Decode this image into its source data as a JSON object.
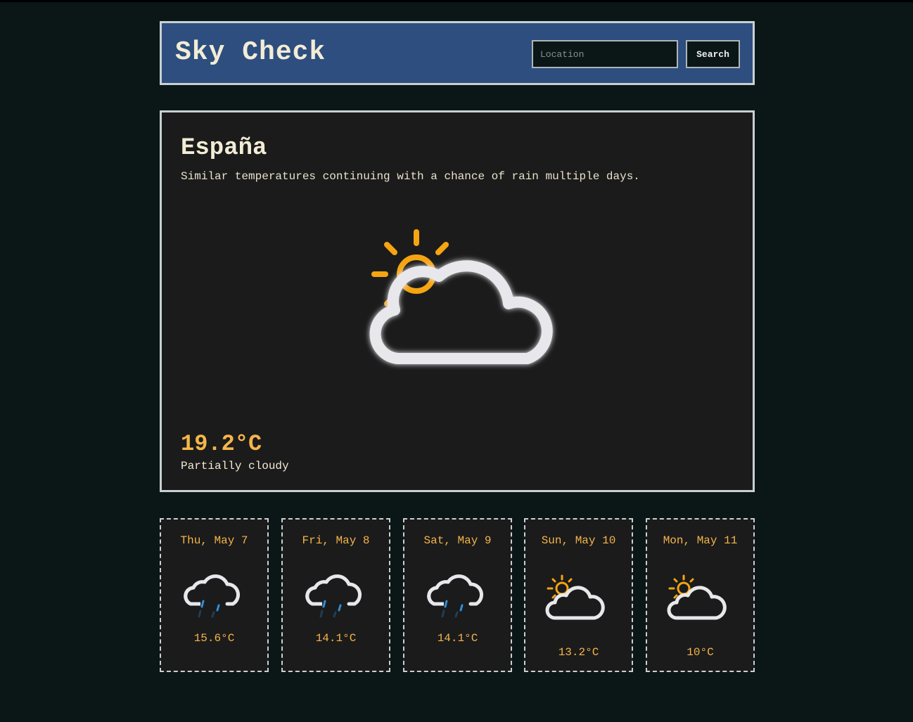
{
  "header": {
    "title": "Sky Check",
    "search_placeholder": "Location",
    "search_value": "",
    "search_button": "Search"
  },
  "current": {
    "location": "España",
    "summary": "Similar temperatures continuing with a chance of rain multiple days.",
    "icon": "partly-cloudy-icon",
    "temperature": "19.2°C",
    "condition": "Partially cloudy"
  },
  "forecast": [
    {
      "date": "Thu, May 7",
      "icon": "rain-icon",
      "temperature": "15.6°C"
    },
    {
      "date": "Fri, May 8",
      "icon": "rain-icon",
      "temperature": "14.1°C"
    },
    {
      "date": "Sat, May 9",
      "icon": "rain-icon",
      "temperature": "14.1°C"
    },
    {
      "date": "Sun, May 10",
      "icon": "partly-cloudy-icon",
      "temperature": "13.2°C"
    },
    {
      "date": "Mon, May 11",
      "icon": "partly-cloudy-icon",
      "temperature": "10°C"
    }
  ],
  "colors": {
    "background": "#0b1617",
    "header": "#2d4e7e",
    "panel": "#1b1b1b",
    "accent": "#f5b54a",
    "sun": "#f6a412",
    "rain": "#2e8ed8",
    "cloud": "#e8e8ec"
  }
}
